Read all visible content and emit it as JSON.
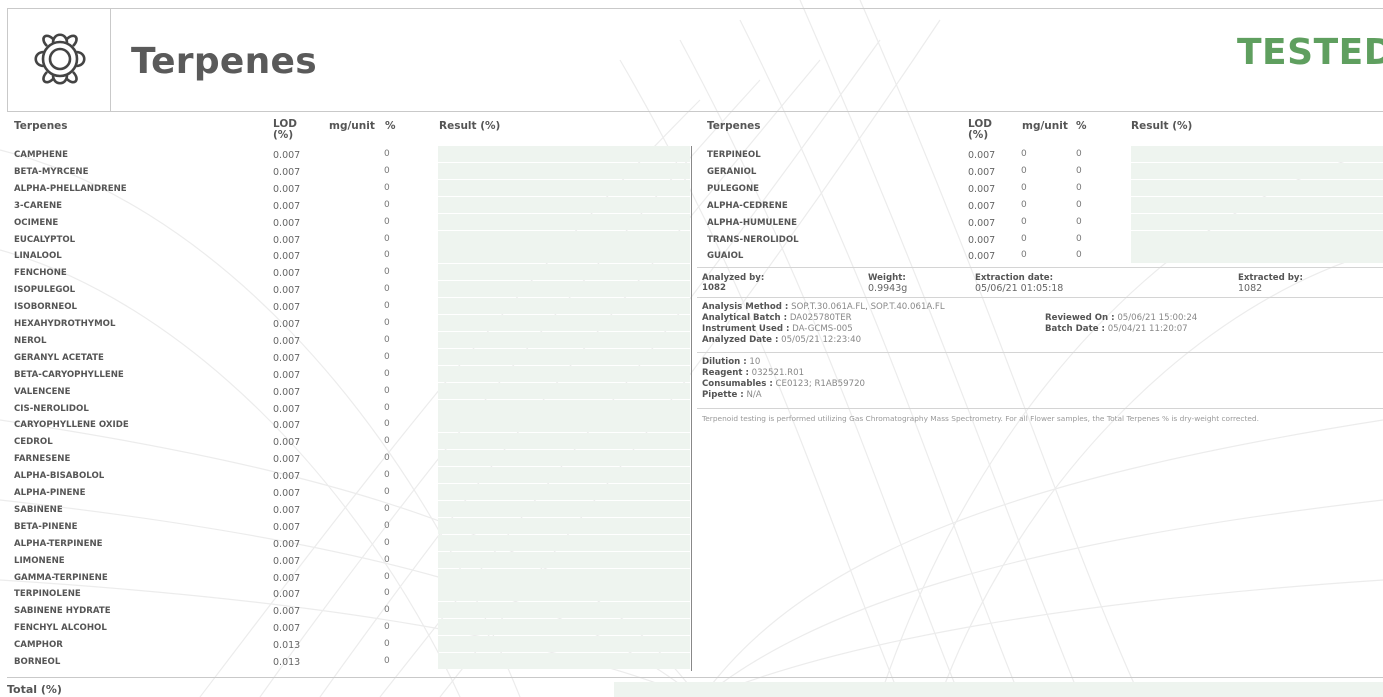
{
  "header": {
    "title": "Terpenes",
    "status": "TESTED",
    "logo_icon": "flower-icon",
    "status_color": "#5f9f5f"
  },
  "table_headers": {
    "name": "Terpenes",
    "lod": "LOD\n(%)",
    "mg": "mg/unit",
    "pct": "%",
    "result": "Result (%)"
  },
  "left_rows": [
    {
      "name": "CAMPHENE",
      "lod": "0.007",
      "mg": "0"
    },
    {
      "name": "BETA-MYRCENE",
      "lod": "0.007",
      "mg": "0"
    },
    {
      "name": "ALPHA-PHELLANDRENE",
      "lod": "0.007",
      "mg": "0"
    },
    {
      "name": "3-CARENE",
      "lod": "0.007",
      "mg": "0"
    },
    {
      "name": "OCIMENE",
      "lod": "0.007",
      "mg": "0"
    },
    {
      "name": "EUCALYPTOL",
      "lod": "0.007",
      "mg": "0"
    },
    {
      "name": "LINALOOL",
      "lod": "0.007",
      "mg": "0"
    },
    {
      "name": "FENCHONE",
      "lod": "0.007",
      "mg": "0"
    },
    {
      "name": "ISOPULEGOL",
      "lod": "0.007",
      "mg": "0"
    },
    {
      "name": "ISOBORNEOL",
      "lod": "0.007",
      "mg": "0"
    },
    {
      "name": "HEXAHYDROTHYMOL",
      "lod": "0.007",
      "mg": "0"
    },
    {
      "name": "NEROL",
      "lod": "0.007",
      "mg": "0"
    },
    {
      "name": "GERANYL ACETATE",
      "lod": "0.007",
      "mg": "0"
    },
    {
      "name": "BETA-CARYOPHYLLENE",
      "lod": "0.007",
      "mg": "0"
    },
    {
      "name": "VALENCENE",
      "lod": "0.007",
      "mg": "0"
    },
    {
      "name": "CIS-NEROLIDOL",
      "lod": "0.007",
      "mg": "0"
    },
    {
      "name": "CARYOPHYLLENE OXIDE",
      "lod": "0.007",
      "mg": "0"
    },
    {
      "name": "CEDROL",
      "lod": "0.007",
      "mg": "0"
    },
    {
      "name": "FARNESENE",
      "lod": "0.007",
      "mg": "0"
    },
    {
      "name": "ALPHA-BISABOLOL",
      "lod": "0.007",
      "mg": "0"
    },
    {
      "name": "ALPHA-PINENE",
      "lod": "0.007",
      "mg": "0"
    },
    {
      "name": "SABINENE",
      "lod": "0.007",
      "mg": "0"
    },
    {
      "name": "BETA-PINENE",
      "lod": "0.007",
      "mg": "0"
    },
    {
      "name": "ALPHA-TERPINENE",
      "lod": "0.007",
      "mg": "0"
    },
    {
      "name": "LIMONENE",
      "lod": "0.007",
      "mg": "0"
    },
    {
      "name": "GAMMA-TERPINENE",
      "lod": "0.007",
      "mg": "0"
    },
    {
      "name": "TERPINOLENE",
      "lod": "0.007",
      "mg": "0"
    },
    {
      "name": "SABINENE HYDRATE",
      "lod": "0.007",
      "mg": "0"
    },
    {
      "name": "FENCHYL ALCOHOL",
      "lod": "0.007",
      "mg": "0"
    },
    {
      "name": "CAMPHOR",
      "lod": "0.013",
      "mg": "0"
    },
    {
      "name": "BORNEOL",
      "lod": "0.013",
      "mg": "0"
    }
  ],
  "right_rows": [
    {
      "name": "TERPINEOL",
      "lod": "0.007",
      "mg": "0",
      "pct": "0"
    },
    {
      "name": "GERANIOL",
      "lod": "0.007",
      "mg": "0",
      "pct": "0"
    },
    {
      "name": "PULEGONE",
      "lod": "0.007",
      "mg": "0",
      "pct": "0"
    },
    {
      "name": "ALPHA-CEDRENE",
      "lod": "0.007",
      "mg": "0",
      "pct": "0"
    },
    {
      "name": "ALPHA-HUMULENE",
      "lod": "0.007",
      "mg": "0",
      "pct": "0"
    },
    {
      "name": "TRANS-NEROLIDOL",
      "lod": "0.007",
      "mg": "0",
      "pct": "0"
    },
    {
      "name": "GUAIOL",
      "lod": "0.007",
      "mg": "0",
      "pct": "0"
    }
  ],
  "analysis_meta": {
    "analyzed_by_label": "Analyzed by:",
    "analyzed_by": "1082",
    "weight_label": "Weight:",
    "weight": "0.9943g",
    "extraction_date_label": "Extraction date:",
    "extraction_date": "05/06/21 01:05:18",
    "extracted_by_label": "Extracted by:",
    "extracted_by": "1082"
  },
  "analysis_info": {
    "method_label": "Analysis Method :",
    "method": "SOP.T.30.061A.FL, SOP.T.40.061A.FL",
    "batch_label": "Analytical Batch :",
    "batch": "DA025780TER",
    "instrument_label": "Instrument Used :",
    "instrument": "DA-GCMS-005",
    "analyzed_date_label": "Analyzed Date :",
    "analyzed_date": "05/05/21 12:23:40",
    "reviewed_label": "Reviewed On :",
    "reviewed": "05/06/21 15:00:24",
    "batch_date_label": "Batch Date :",
    "batch_date": "05/04/21 11:20:07"
  },
  "reagents": {
    "dilution_label": "Dilution :",
    "dilution": "10",
    "reagent_label": "Reagent :",
    "reagent": "032521.R01",
    "consumables_label": "Consumables :",
    "consumables": "CE0123; R1AB59720",
    "pipette_label": "Pipette :",
    "pipette": "N/A"
  },
  "note": "Terpenoid testing is performed utilizing Gas Chromatography Mass Spectrometry. For all Flower samples, the Total Terpenes % is dry-weight corrected.",
  "total": {
    "label": "Total (%)"
  },
  "colors": {
    "bar": "#eef4ef",
    "tested": "#5f9f5f"
  }
}
